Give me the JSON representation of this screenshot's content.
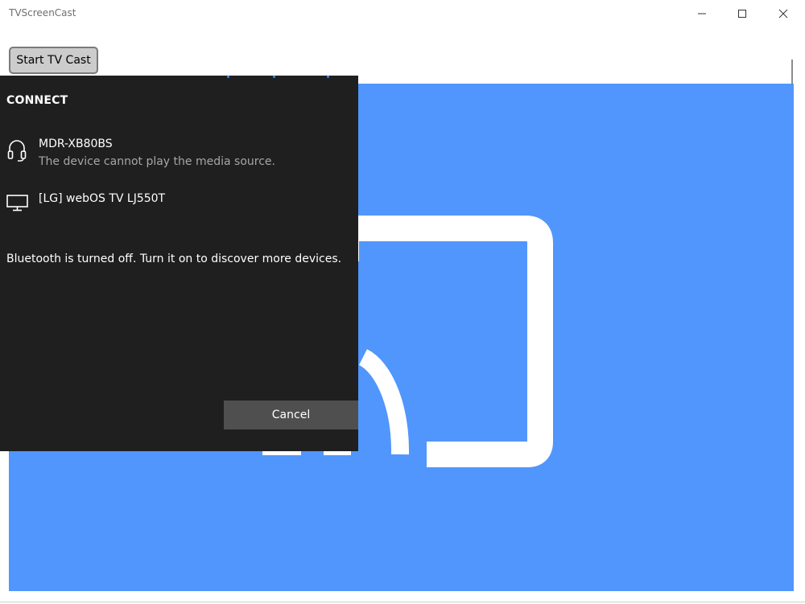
{
  "window": {
    "title": "TVScreenCast"
  },
  "toolbar": {
    "start_label": "Start TV Cast"
  },
  "connect_panel": {
    "title": "CONNECT",
    "devices": [
      {
        "name": "MDR-XB80BS",
        "status": "The device cannot play the media source.",
        "icon": "headphones-icon"
      },
      {
        "name": "[LG] webOS TV LJ550T",
        "status": "",
        "icon": "monitor-icon"
      }
    ],
    "bluetooth_message": "Bluetooth is turned off. Turn it on to discover more devices.",
    "cancel_label": "Cancel"
  },
  "colors": {
    "cast_background": "#5196fc",
    "panel_background": "#1f1f1f",
    "cancel_button": "#4f4f4f",
    "progress_dots": "#2f8fff"
  }
}
